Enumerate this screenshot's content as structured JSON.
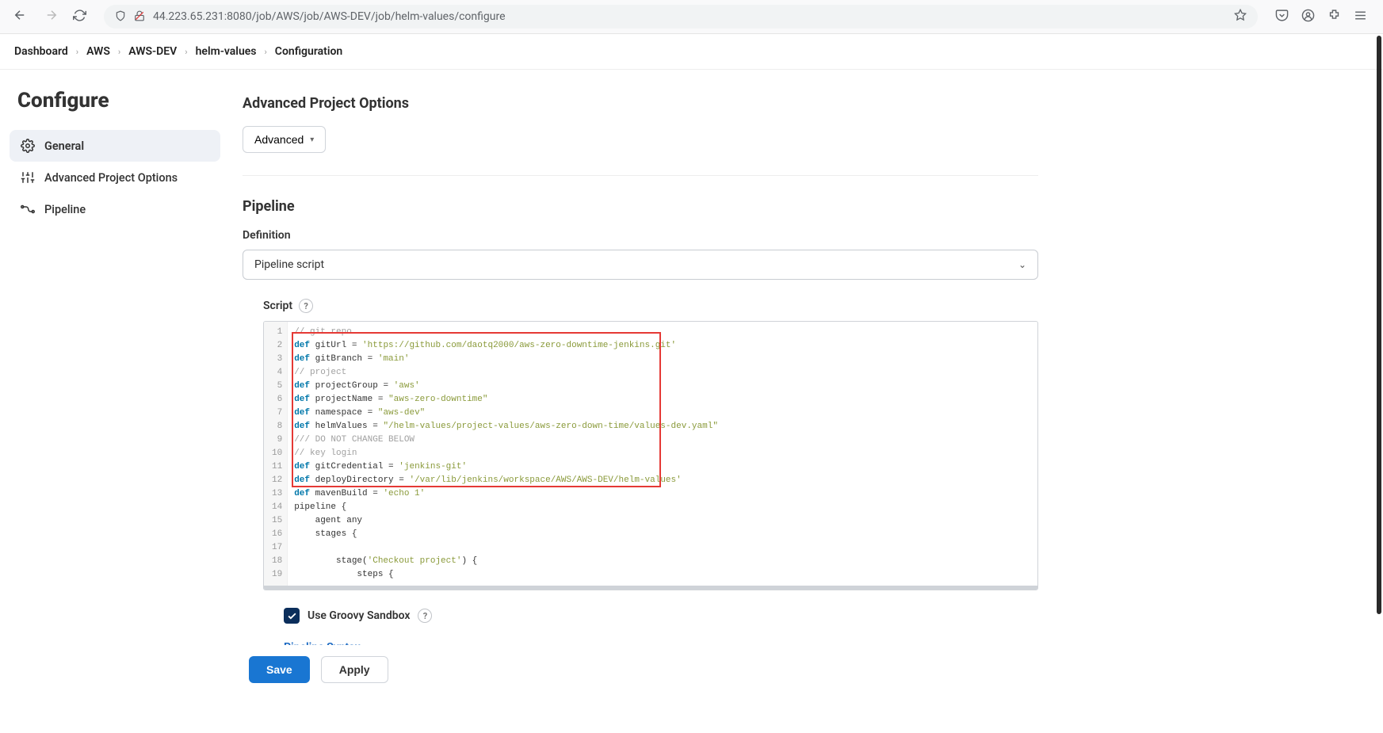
{
  "browser": {
    "url": "44.223.65.231:8080/job/AWS/job/AWS-DEV/job/helm-values/configure"
  },
  "breadcrumbs": [
    "Dashboard",
    "AWS",
    "AWS-DEV",
    "helm-values",
    "Configuration"
  ],
  "page_title": "Configure",
  "sidebar": {
    "items": [
      {
        "label": "General"
      },
      {
        "label": "Advanced Project Options"
      },
      {
        "label": "Pipeline"
      }
    ]
  },
  "sections": {
    "advanced": {
      "heading": "Advanced Project Options",
      "button": "Advanced"
    },
    "pipeline": {
      "heading": "Pipeline",
      "definition_label": "Definition",
      "definition_value": "Pipeline script",
      "script_label": "Script",
      "sandbox_label": "Use Groovy Sandbox",
      "syntax_link": "Pipeline Syntax"
    }
  },
  "script": {
    "gutter": [
      "1",
      "2",
      "3",
      "4",
      "5",
      "6",
      "7",
      "8",
      "9",
      "10",
      "11",
      "12",
      "13",
      "14",
      "15",
      "16",
      "17",
      "18",
      "19"
    ],
    "lines": [
      {
        "type": "cm",
        "indent": 0,
        "text": "// git repo"
      },
      {
        "type": "def",
        "indent": 0,
        "name": "gitUrl",
        "val": "'https://github.com/daotq2000/aws-zero-downtime-jenkins.git'"
      },
      {
        "type": "def",
        "indent": 0,
        "name": "gitBranch",
        "val": "'main'"
      },
      {
        "type": "cm",
        "indent": 0,
        "text": "// project"
      },
      {
        "type": "def",
        "indent": 0,
        "name": "projectGroup",
        "val": "'aws'"
      },
      {
        "type": "def",
        "indent": 0,
        "name": "projectName",
        "val": "\"aws-zero-downtime\""
      },
      {
        "type": "def",
        "indent": 0,
        "name": "namespace",
        "val": "\"aws-dev\""
      },
      {
        "type": "def",
        "indent": 0,
        "name": "helmValues",
        "val": "\"/helm-values/project-values/aws-zero-down-time/values-dev.yaml\""
      },
      {
        "type": "cm",
        "indent": 0,
        "text": "/// DO NOT CHANGE BELOW"
      },
      {
        "type": "cm",
        "indent": 0,
        "text": "// key login"
      },
      {
        "type": "def",
        "indent": 0,
        "name": "gitCredential",
        "val": "'jenkins-git'"
      },
      {
        "type": "def",
        "indent": 0,
        "name": "deployDirectory",
        "val": "'/var/lib/jenkins/workspace/AWS/AWS-DEV/helm-values'"
      },
      {
        "type": "def",
        "indent": 0,
        "name": "mavenBuild",
        "val": "'echo 1'"
      },
      {
        "type": "raw",
        "indent": 0,
        "html": "pipeline {"
      },
      {
        "type": "raw",
        "indent": 1,
        "html": "agent any"
      },
      {
        "type": "raw",
        "indent": 1,
        "html": "stages {"
      },
      {
        "type": "raw",
        "indent": 1,
        "html": ""
      },
      {
        "type": "stage",
        "indent": 2,
        "label": "'Checkout project'"
      },
      {
        "type": "raw",
        "indent": 3,
        "html": "steps {"
      }
    ]
  },
  "actions": {
    "save": "Save",
    "apply": "Apply"
  }
}
